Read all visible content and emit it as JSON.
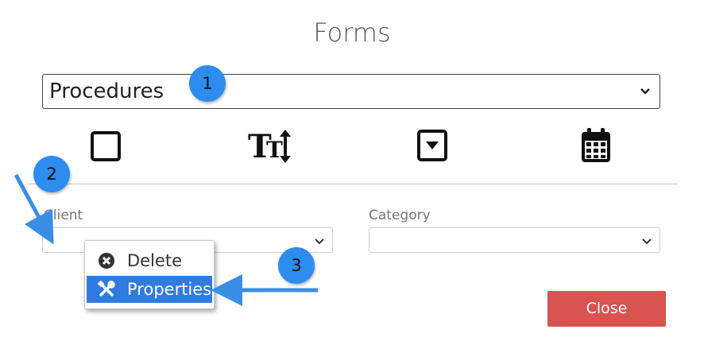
{
  "dialog": {
    "title": "Forms",
    "form_select": {
      "value": "Procedures"
    },
    "toolbar_icons": [
      "checkbox-icon",
      "text-field-icon",
      "dropdown-icon",
      "calendar-icon"
    ],
    "fields": [
      {
        "label": "Client",
        "value": ""
      },
      {
        "label": "Category",
        "value": ""
      }
    ],
    "context_menu": {
      "items": [
        {
          "label": "Delete",
          "icon": "delete-circle-icon",
          "selected": false
        },
        {
          "label": "Properties",
          "icon": "tools-icon",
          "selected": true
        }
      ]
    },
    "close_label": "Close"
  },
  "callouts": [
    "1",
    "2",
    "3"
  ],
  "colors": {
    "accent_blue": "#2d8cf0",
    "menu_selected": "#2f7be0",
    "close_button": "#d9534f",
    "arrow": "#3a8ee6"
  }
}
